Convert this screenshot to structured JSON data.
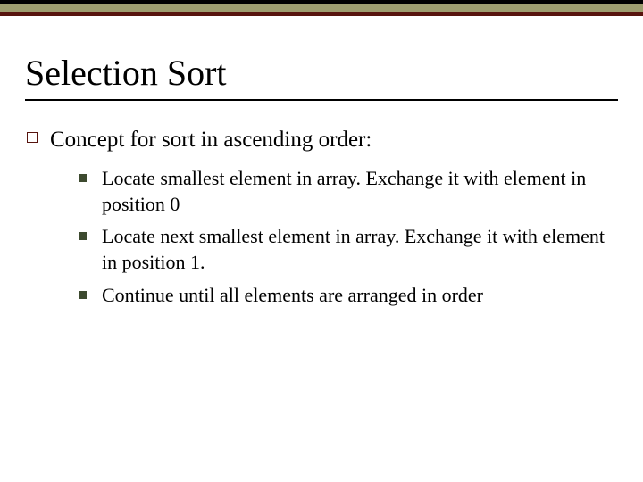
{
  "title": "Selection Sort",
  "level1": [
    {
      "text": "Concept for sort in ascending order:",
      "sub": [
        "Locate smallest element in array.  Exchange it with element in position 0",
        "Locate next smallest element in array.  Exchange it with element in position 1.",
        "Continue until all elements are arranged in order"
      ]
    }
  ]
}
